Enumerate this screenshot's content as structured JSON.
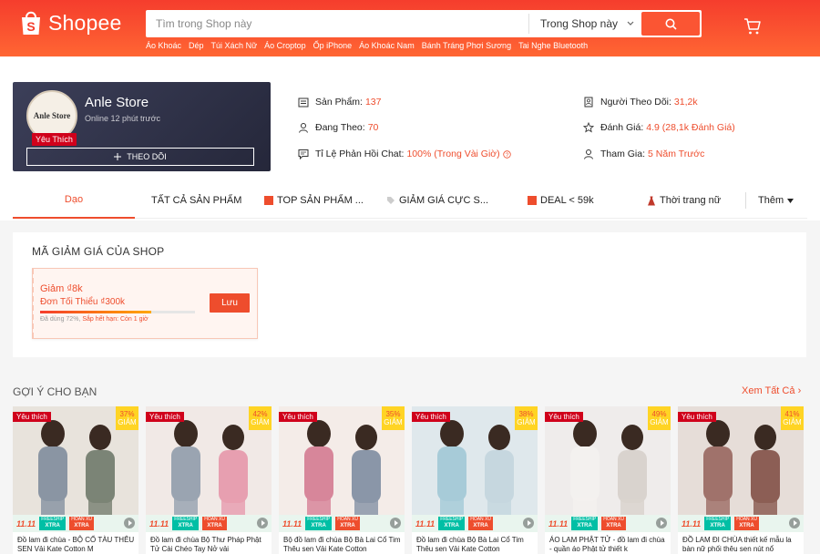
{
  "header": {
    "logo_text": "Shopee",
    "search_placeholder": "Tìm trong Shop này",
    "search_scope": "Trong Shop này",
    "quick_links": [
      "Áo Khoác",
      "Dép",
      "Túi Xách Nữ",
      "Áo Croptop",
      "Ốp iPhone",
      "Áo Khoác Nam",
      "Bánh Tráng Phơi Sương",
      "Tai Nghe Bluetooth"
    ],
    "icons": {
      "search": "search-icon",
      "cart": "cart-icon",
      "dropdown": "chevron-down-icon"
    }
  },
  "shop": {
    "avatar_text": "Anle Store",
    "name": "Anle Store",
    "online": "Online 12 phút trước",
    "badge": "Yêu Thích",
    "follow_label": "THEO DÕI",
    "stats": {
      "products": {
        "label": "Sản Phẩm:",
        "value": "137"
      },
      "following": {
        "label": "Đang Theo:",
        "value": "70"
      },
      "chat": {
        "label": "Tỉ Lệ Phản Hồi Chat:",
        "value": "100% (Trong Vài Giờ)"
      },
      "followers": {
        "label": "Người Theo Dõi:",
        "value": "31,2k"
      },
      "rating": {
        "label": "Đánh Giá:",
        "value": "4.9 (28,1k Đánh Giá)"
      },
      "joined": {
        "label": "Tham Gia:",
        "value": "5 Năm Trước"
      }
    }
  },
  "tabs": {
    "items": [
      "Dạo",
      "TẤT CẢ SẢN PHẨM",
      "TOP SẢN PHẨM ...",
      "GIẢM GIÁ CỰC S...",
      "DEAL < 59k",
      "Thời trang nữ"
    ],
    "more": "Thêm"
  },
  "vouchers": {
    "title": "MÃ GIẢM GIÁ CỦA SHOP",
    "items": [
      {
        "discount": "Giảm ₫8k",
        "min": "Đơn Tối Thiểu ₫300k",
        "used_pct": 72,
        "used_text": "Đã dùng 72%,",
        "expiry": "Sắp hết hạn: Còn 1 giờ",
        "save_label": "Lưu"
      }
    ]
  },
  "recommend": {
    "title": "GỢI Ý CHO BẠN",
    "see_all": "Xem Tất Cả",
    "fav_tag": "Yêu thích",
    "discount_word": "GIẢM",
    "promo_1111": "11.11",
    "chip_freeship_top": "FREESHIP",
    "chip_freeship_big": "XTRA",
    "chip_hoantien_top": "HOÀN XU",
    "chip_hoantien_big": "XTRA",
    "products": [
      {
        "discount": "37%",
        "name": "Đồ lam đi chùa - BỘ CỔ TÀU THÊU SEN Vải Kate Cotton M"
      },
      {
        "discount": "42%",
        "name": "Đồ lam đi chùa Bộ Thư Pháp Phật Tử Cài Chéo Tay Nở vải"
      },
      {
        "discount": "35%",
        "name": "Bộ đồ lam đi chùa Bộ Bà Lai Cổ Tim Thêu sen Vải Kate Cotton"
      },
      {
        "discount": "38%",
        "name": "Đồ lam đi chùa Bộ Bà Lai Cổ Tim Thêu sen Vải Kate Cotton"
      },
      {
        "discount": "49%",
        "name": "ÁO LAM PHẬT TỬ - đồ lam đi chùa - quần áo Phật tử thiết k"
      },
      {
        "discount": "41%",
        "name": "ĐỒ LAM ĐI CHÙA thiết kế mẫu la bàn nữ phối thêu sen nút nổ"
      }
    ]
  },
  "colors": {
    "brand": "#ee4d2d",
    "header_top": "#f53d2d",
    "header_bottom": "#ff6633",
    "shop_card": "#2f3147"
  }
}
